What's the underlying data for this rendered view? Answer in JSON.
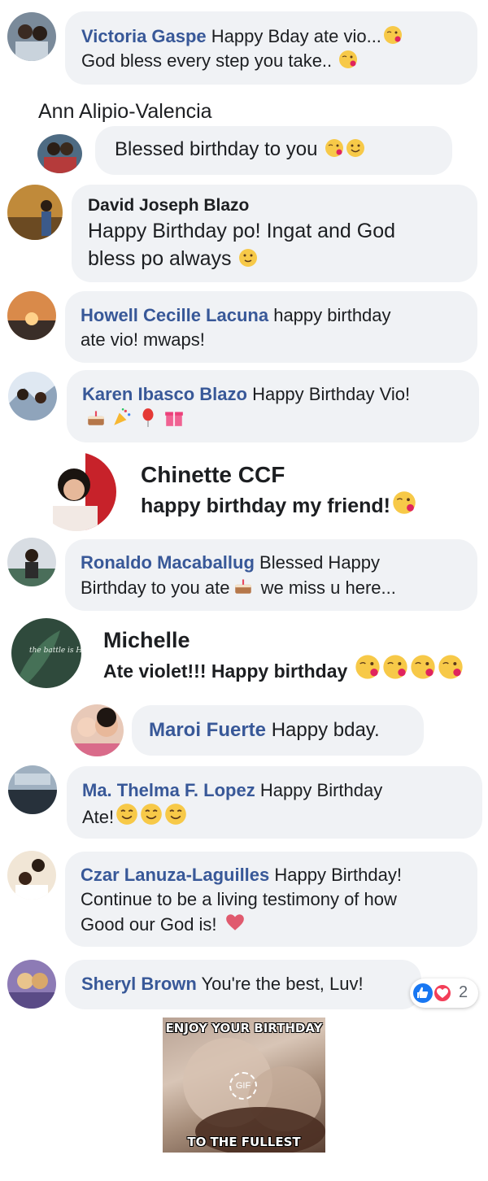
{
  "comments": [
    {
      "name": "Victoria Gaspe",
      "text": "Happy Bday ate vio...",
      "text2": "God bless every step you take.."
    },
    {
      "header": "Ann Alipio-Valencia",
      "text": "Blessed birthday to you"
    },
    {
      "name": "David Joseph Blazo",
      "line1": "Happy Birthday po! Ingat and God",
      "line2": "bless po always"
    },
    {
      "name": "Howell Cecille Lacuna",
      "line1": "happy birthday",
      "line2": "ate vio! mwaps!"
    },
    {
      "name": "Karen Ibasco Blazo",
      "text": "Happy Birthday Vio!"
    },
    {
      "name": "Chinette CCF",
      "text": "happy birthday my friend!"
    },
    {
      "name": "Ronaldo Macaballug",
      "line1": "Blessed Happy",
      "line2a": "Birthday to you ate",
      "line2b": "we miss u here..."
    },
    {
      "name": "Michelle",
      "text": "Ate violet!!! Happy birthday"
    },
    {
      "name": "Maroi Fuerte",
      "text": "Happy bday."
    },
    {
      "name": "Ma. Thelma F. Lopez",
      "line1": "Happy Birthday",
      "line2": "Ate!"
    },
    {
      "name": "Czar Lanuza-Laguilles",
      "line1": "Happy Birthday!",
      "line2": "Continue to be a living testimony of how",
      "line3": "Good our God is!"
    },
    {
      "name": "Sheryl Brown",
      "text": "You're the best, Luv!",
      "reaction_count": "2"
    }
  ],
  "avatar_watermark": "the battle is His",
  "gif": {
    "badge": "GIF",
    "top_caption": "ENJOY YOUR BIRTHDAY",
    "bottom_caption": "TO THE FULLEST"
  }
}
